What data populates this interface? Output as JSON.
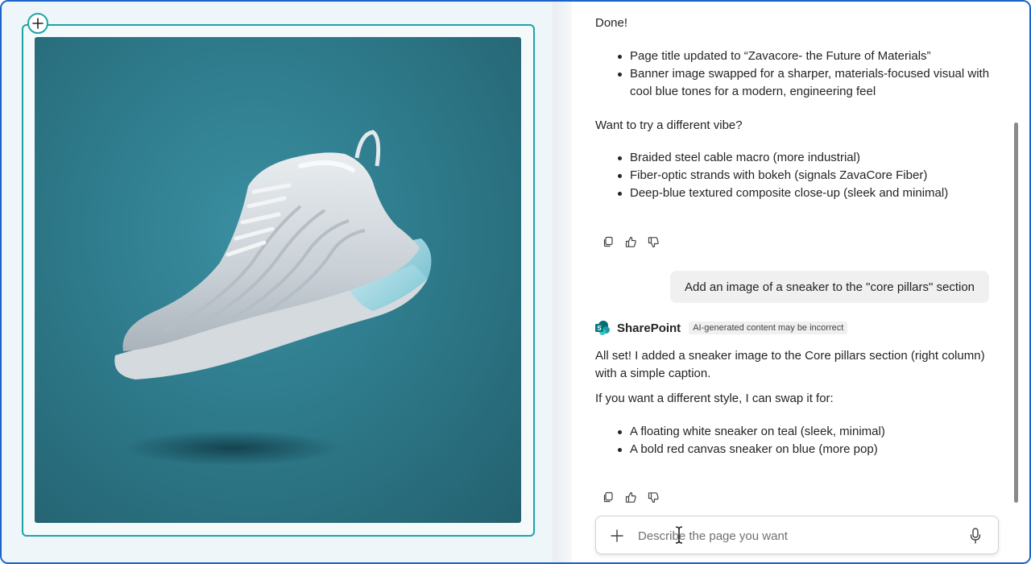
{
  "canvas": {
    "image_alt": "Floating white sneaker on teal background"
  },
  "chat": {
    "message1": {
      "intro": "Done!",
      "bullets": [
        "Page title updated to “Zavacore- the Future of Materials”",
        "Banner image swapped for a sharper, materials-focused visual with cool blue tones for a modern, engineering feel"
      ],
      "question": "Want to try a different vibe?",
      "options": [
        "Braided steel cable macro (more industrial)",
        "Fiber-optic strands with bokeh (signals ZavaCore Fiber)",
        "Deep-blue textured composite close-up (sleek and minimal)"
      ]
    },
    "user_message": "Add an image of a sneaker to the \"core pillars\" section",
    "bot": {
      "name": "SharePoint",
      "badge": "AI-generated content may be incorrect"
    },
    "message2": {
      "para1": "All set! I added a sneaker image to the Core pillars section (right column) with a simple caption.",
      "para2": "If you want a different style, I can swap it for:",
      "options": [
        "A floating white sneaker on teal (sleek, minimal)",
        "A bold red canvas sneaker on blue (more pop)"
      ]
    },
    "composer": {
      "placeholder": "Describe the page you want"
    }
  },
  "colors": {
    "frame_border": "#1b63c9",
    "section_outline": "#1ea4a8",
    "image_background": "#2f7d8e"
  }
}
